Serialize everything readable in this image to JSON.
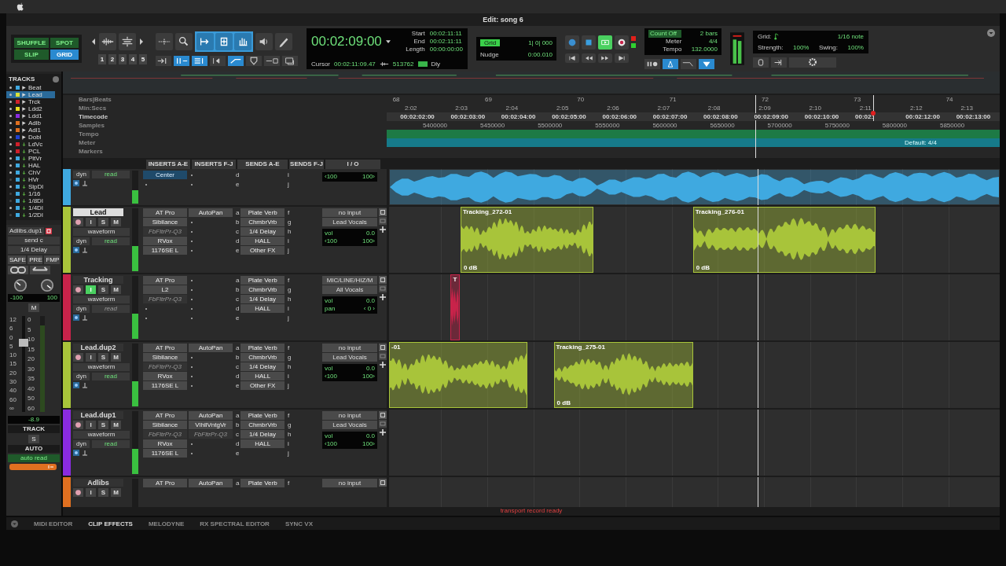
{
  "window": {
    "title": "Edit: song 6"
  },
  "modes": [
    {
      "label": "SHUFFLE",
      "selected": false
    },
    {
      "label": "SPOT",
      "selected": false
    },
    {
      "label": "SLIP",
      "selected": false
    },
    {
      "label": "GRID",
      "selected": true
    }
  ],
  "zoom_presets": [
    "1",
    "2",
    "3",
    "4",
    "5"
  ],
  "counter": {
    "main": "00:02:09:00",
    "start_label": "Start",
    "start": "00:02:11:11",
    "end_label": "End",
    "end": "00:02:11:11",
    "length_label": "Length",
    "length": "00:00:00:00",
    "cursor_label": "Cursor",
    "cursor": "00:02:11:09.47",
    "samples": "513762",
    "dly": "Dly"
  },
  "grid_nudge": {
    "grid_label": "Grid",
    "grid": "1| 0| 000",
    "nudge_label": "Nudge",
    "nudge": "0:00.010"
  },
  "count": {
    "count_off": "Count Off",
    "bars": "2 bars",
    "meter_label": "Meter",
    "meter": "4/4",
    "tempo_label": "Tempo",
    "tempo": "132.0000"
  },
  "grid_panel": {
    "grid_label": "Grid:",
    "grid": "1/16 note",
    "strength_label": "Strength:",
    "strength": "100%",
    "swing_label": "Swing:",
    "swing": "100%"
  },
  "track_list": {
    "title": "TRACKS",
    "items": [
      {
        "name": "Beat",
        "color": "#3fa9e0",
        "kind": "audio",
        "shown": true,
        "selected": false
      },
      {
        "name": "Lead",
        "color": "#d8e03a",
        "kind": "audio",
        "shown": true,
        "selected": true
      },
      {
        "name": "Trck",
        "color": "#d0202a",
        "kind": "audio",
        "shown": true,
        "selected": false
      },
      {
        "name": "Ldd2",
        "color": "#e8e020",
        "kind": "audio",
        "shown": true,
        "selected": false
      },
      {
        "name": "Ldd1",
        "color": "#8a2be0",
        "kind": "audio",
        "shown": true,
        "selected": false
      },
      {
        "name": "Adlb",
        "color": "#e07020",
        "kind": "audio",
        "shown": true,
        "selected": false
      },
      {
        "name": "Adl1",
        "color": "#e07020",
        "kind": "audio",
        "shown": true,
        "selected": false
      },
      {
        "name": "Dobl",
        "color": "#2040d0",
        "kind": "audio",
        "shown": true,
        "selected": false
      },
      {
        "name": "LdVc",
        "color": "#d0202a",
        "kind": "aux",
        "shown": true,
        "selected": false
      },
      {
        "name": "PCL",
        "color": "#d0202a",
        "kind": "aux",
        "shown": true,
        "selected": false
      },
      {
        "name": "PltVr",
        "color": "#3fa9e0",
        "kind": "aux",
        "shown": true,
        "selected": false
      },
      {
        "name": "HAL",
        "color": "#3fa9e0",
        "kind": "aux",
        "shown": true,
        "selected": false
      },
      {
        "name": "ChV",
        "color": "#3fa9e0",
        "kind": "aux",
        "shown": true,
        "selected": false
      },
      {
        "name": "HVr",
        "color": "#3fa9e0",
        "kind": "aux",
        "shown": false,
        "selected": false
      },
      {
        "name": "SlpDl",
        "color": "#3fa9e0",
        "kind": "aux",
        "shown": true,
        "selected": false
      },
      {
        "name": "1/16",
        "color": "#3fa9e0",
        "kind": "aux",
        "shown": false,
        "selected": false
      },
      {
        "name": "1/8Dl",
        "color": "#3fa9e0",
        "kind": "aux",
        "shown": false,
        "selected": false
      },
      {
        "name": "1/4Dl",
        "color": "#3fa9e0",
        "kind": "aux",
        "shown": true,
        "selected": false
      },
      {
        "name": "1/2Dl",
        "color": "#3fa9e0",
        "kind": "aux",
        "shown": false,
        "selected": false
      }
    ]
  },
  "inspector": {
    "track": "Adlibs.dup1",
    "send": "send c",
    "send_name": "1/4 Delay",
    "buttons": [
      "SAFE",
      "PRE",
      "FMP"
    ],
    "pan": [
      "-100",
      "100"
    ],
    "mute": "M",
    "fader_scale": [
      "12",
      "6",
      "0",
      "5",
      "10",
      "15",
      "20",
      "30",
      "40",
      "60",
      "∞"
    ],
    "meter_scale": [
      "0",
      "5",
      "10",
      "15",
      "20",
      "30",
      "35",
      "40",
      "50",
      "60"
    ],
    "level": 0.72,
    "volume": "-8.9",
    "track_label": "TRACK",
    "solo": "S",
    "auto_label": "AUTO",
    "auto_mode": "auto read"
  },
  "rulers": {
    "labels": [
      "Bars|Beats",
      "Min:Secs",
      "Timecode",
      "Samples",
      "Tempo",
      "Meter",
      "Markers"
    ],
    "bars": [
      "68",
      "69",
      "70",
      "71",
      "72",
      "73",
      "74"
    ],
    "min_secs": [
      "2:02",
      "2:03",
      "2:04",
      "2:05",
      "2:06",
      "2:07",
      "2:08",
      "2:09",
      "2:10",
      "2:11",
      "2:12",
      "2:13"
    ],
    "timecode": [
      "00:02:02:00",
      "00:02:03:00",
      "00:02:04:00",
      "00:02:05:00",
      "00:02:06:00",
      "00:02:07:00",
      "00:02:08:00",
      "00:02:09:00",
      "00:02:10:00",
      "00:02:",
      "00:02:12:00",
      "00:02:13:00"
    ],
    "samples": [
      "5400000",
      "5450000",
      "5500000",
      "5550000",
      "5600000",
      "5650000",
      "5700000",
      "5750000",
      "5800000",
      "5850000"
    ],
    "meter": "Default: 4/4"
  },
  "columns": [
    "INSERTS A-E",
    "INSERTS F-J",
    "SENDS A-E",
    "SENDS F-J",
    "I / O"
  ],
  "tracks": [
    {
      "color": "#3fa9e0",
      "auto_dyn": "dyn",
      "auto_mode": "read",
      "auto_enabled": true,
      "inserts_ae": [
        {
          "kind": "pan",
          "name": "Center"
        },
        {
          "kind": "empty"
        }
      ],
      "inserts_fj": [
        {
          "kind": "empty"
        },
        {
          "kind": "empty"
        }
      ],
      "sends_ae": [
        {
          "slot": "d"
        },
        {
          "slot": "e"
        }
      ],
      "sends_fj": [
        "i",
        "j"
      ],
      "io": {
        "pan": [
          "‹100",
          "100›"
        ]
      },
      "clips": [
        {
          "kind": "audio"
        }
      ]
    },
    {
      "name": "Lead",
      "color": "#a8c43a",
      "selected": true,
      "input_monitor": false,
      "buttons": [
        "I",
        "S",
        "M"
      ],
      "view": "waveform",
      "auto_dyn": "dyn",
      "auto_mode": "read",
      "auto_enabled": true,
      "inserts_ae": [
        {
          "kind": "plugin",
          "name": "AT Pro",
          "active": true
        },
        {
          "kind": "plugin",
          "name": "Sibilance",
          "active": true
        },
        {
          "kind": "plugin",
          "name": "FbFltrPr-Q3",
          "active": false
        },
        {
          "kind": "plugin",
          "name": "RVox",
          "active": true
        },
        {
          "kind": "plugin",
          "name": "1176SE L",
          "active": true
        }
      ],
      "inserts_fj": [
        {
          "kind": "plugin",
          "name": "AutoPan",
          "active": true
        },
        {
          "kind": "empty"
        },
        {
          "kind": "empty"
        },
        {
          "kind": "empty"
        },
        {
          "kind": "empty"
        }
      ],
      "sends_ae": [
        {
          "slot": "a",
          "name": "Plate Verb"
        },
        {
          "slot": "b",
          "name": "ChmbrVrb"
        },
        {
          "slot": "c",
          "name": "1/4 Delay"
        },
        {
          "slot": "d",
          "name": "HALL"
        },
        {
          "slot": "e",
          "name": "Other FX"
        }
      ],
      "sends_fj": [
        "f",
        "g",
        "h",
        "i",
        "j"
      ],
      "io": {
        "input": "no input",
        "output": "Lead Vocals",
        "vol_label": "vol",
        "vol": "0.0",
        "pan": [
          "‹100",
          "100›"
        ]
      },
      "clips": [
        {
          "kind": "audio",
          "name": "Tracking_272-01",
          "gain": "0 dB"
        },
        {
          "kind": "audio",
          "name": "Tracking_276-01",
          "gain": "0 dB"
        }
      ]
    },
    {
      "name": "Tracking",
      "color": "#c8234a",
      "selected": false,
      "input_monitor": true,
      "buttons": [
        "I",
        "S",
        "M"
      ],
      "view": "waveform",
      "auto_dyn": "dyn",
      "auto_mode": "read",
      "auto_enabled": false,
      "inserts_ae": [
        {
          "kind": "plugin",
          "name": "AT Pro",
          "active": true
        },
        {
          "kind": "plugin",
          "name": "L2",
          "active": true
        },
        {
          "kind": "plugin",
          "name": "FbFltrPr-Q3",
          "active": false
        },
        {
          "kind": "empty"
        },
        {
          "kind": "empty"
        }
      ],
      "inserts_fj": [
        {
          "kind": "empty"
        },
        {
          "kind": "empty"
        },
        {
          "kind": "empty"
        },
        {
          "kind": "empty"
        },
        {
          "kind": "empty"
        }
      ],
      "sends_ae": [
        {
          "slot": "a",
          "name": "Plate Verb"
        },
        {
          "slot": "b",
          "name": "ChmbrVrb"
        },
        {
          "slot": "c",
          "name": "1/4 Delay"
        },
        {
          "slot": "d",
          "name": "HALL"
        },
        {
          "slot": "e"
        }
      ],
      "sends_fj": [
        "f",
        "g",
        "h",
        "i",
        "j"
      ],
      "io": {
        "input": "MIC/LINE/HIZ/M",
        "output": "All Vocals",
        "vol_label": "vol",
        "vol": "0.0",
        "pan_label": "pan",
        "pan": [
          "‹ 0 ›"
        ]
      },
      "clips": [
        {
          "kind": "audio",
          "name": "T"
        }
      ]
    },
    {
      "name": "Lead.dup2",
      "color": "#a8c43a",
      "selected": false,
      "input_monitor": false,
      "buttons": [
        "I",
        "S",
        "M"
      ],
      "view": "waveform",
      "auto_dyn": "dyn",
      "auto_mode": "read",
      "auto_enabled": true,
      "inserts_ae": [
        {
          "kind": "plugin",
          "name": "AT Pro",
          "active": true
        },
        {
          "kind": "plugin",
          "name": "Sibilance",
          "active": true
        },
        {
          "kind": "plugin",
          "name": "FbFltrPr-Q3",
          "active": false
        },
        {
          "kind": "plugin",
          "name": "RVox",
          "active": true
        },
        {
          "kind": "plugin",
          "name": "1176SE L",
          "active": true
        }
      ],
      "inserts_fj": [
        {
          "kind": "plugin",
          "name": "AutoPan",
          "active": true
        },
        {
          "kind": "empty"
        },
        {
          "kind": "empty"
        },
        {
          "kind": "empty"
        },
        {
          "kind": "empty"
        }
      ],
      "sends_ae": [
        {
          "slot": "a",
          "name": "Plate Verb"
        },
        {
          "slot": "b",
          "name": "ChmbrVrb"
        },
        {
          "slot": "c",
          "name": "1/4 Delay"
        },
        {
          "slot": "d",
          "name": "HALL"
        },
        {
          "slot": "e",
          "name": "Other FX"
        }
      ],
      "sends_fj": [
        "f",
        "g",
        "h",
        "i",
        "j"
      ],
      "io": {
        "input": "no input",
        "output": "Lead Vocals",
        "vol_label": "vol",
        "vol": "0.0",
        "pan": [
          "‹100",
          "100›"
        ]
      },
      "clips": [
        {
          "kind": "audio",
          "name": "-01"
        },
        {
          "kind": "audio",
          "name": "Tracking_275-01",
          "gain": "0 dB"
        }
      ]
    },
    {
      "name": "Lead.dup1",
      "color": "#8a2be0",
      "selected": false,
      "input_monitor": false,
      "buttons": [
        "I",
        "S",
        "M"
      ],
      "view": "waveform",
      "auto_dyn": "dyn",
      "auto_mode": "read",
      "auto_enabled": true,
      "inserts_ae": [
        {
          "kind": "plugin",
          "name": "AT Pro",
          "active": true
        },
        {
          "kind": "plugin",
          "name": "Sibilance",
          "active": true
        },
        {
          "kind": "plugin",
          "name": "FbFltrPr-Q3",
          "active": false
        },
        {
          "kind": "plugin",
          "name": "RVox",
          "active": true
        },
        {
          "kind": "plugin",
          "name": "1176SE L",
          "active": true
        }
      ],
      "inserts_fj": [
        {
          "kind": "plugin",
          "name": "AutoPan",
          "active": true
        },
        {
          "kind": "plugin",
          "name": "VlhllVntgVr",
          "active": true
        },
        {
          "kind": "plugin",
          "name": "FbFltrPr-Q3",
          "active": false
        },
        {
          "kind": "empty"
        },
        {
          "kind": "empty"
        }
      ],
      "sends_ae": [
        {
          "slot": "a",
          "name": "Plate Verb"
        },
        {
          "slot": "b",
          "name": "ChmbrVrb"
        },
        {
          "slot": "c",
          "name": "1/4 Delay"
        },
        {
          "slot": "d",
          "name": "HALL"
        },
        {
          "slot": "e"
        }
      ],
      "sends_fj": [
        "f",
        "g",
        "h",
        "i",
        "j"
      ],
      "io": {
        "input": "no input",
        "output": "Lead Vocals",
        "vol_label": "vol",
        "vol": "0.0",
        "pan": [
          "‹100",
          "100›"
        ]
      }
    },
    {
      "name": "Adlibs",
      "color": "#e07020",
      "selected": false,
      "input_monitor": false,
      "buttons": [
        "I",
        "S",
        "M"
      ],
      "inserts_ae": [
        {
          "kind": "plugin",
          "name": "AT Pro",
          "active": true
        }
      ],
      "inserts_fj": [
        {
          "kind": "plugin",
          "name": "AutoPan",
          "active": true
        }
      ],
      "sends_ae": [
        {
          "slot": "a",
          "name": "Plate Verb"
        }
      ],
      "sends_fj": [
        "f"
      ],
      "io": {
        "input": "no input"
      }
    }
  ],
  "status": "transport record ready",
  "bottom_tabs": [
    {
      "label": "MIDI EDITOR",
      "selected": false
    },
    {
      "label": "CLIP EFFECTS",
      "selected": true
    },
    {
      "label": "MELODYNE",
      "selected": false
    },
    {
      "label": "RX SPECTRAL EDITOR",
      "selected": false
    },
    {
      "label": "SYNC VX",
      "selected": false
    }
  ]
}
